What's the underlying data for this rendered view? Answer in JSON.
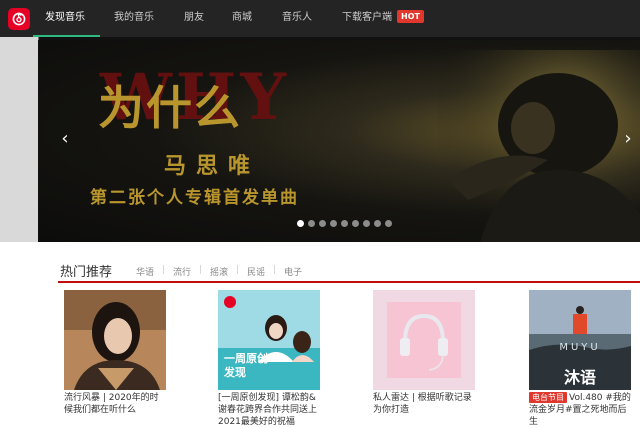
{
  "nav": {
    "items": [
      {
        "label": "发现音乐",
        "active": true
      },
      {
        "label": "我的音乐",
        "active": false
      },
      {
        "label": "朋友",
        "active": false
      },
      {
        "label": "商城",
        "active": false
      },
      {
        "label": "音乐人",
        "active": false
      },
      {
        "label": "下载客户端",
        "active": false
      }
    ],
    "hot_badge": "HOT",
    "active_color": "#2fb87f"
  },
  "banner": {
    "headline": "为什么",
    "watermark": "WHY",
    "artist": "马思唯",
    "subline": "第二张个人专辑首发单曲",
    "prev_arrow": "‹",
    "next_arrow": "›",
    "slide_count": 9,
    "active_slide": 1
  },
  "hot": {
    "title": "热门推荐",
    "tags": [
      "华语",
      "流行",
      "摇滚",
      "民谣",
      "电子"
    ],
    "accent": "#c10d0c",
    "playlists": [
      {
        "caption": "流行风暴 | 2020年的时候我们都在听什么"
      },
      {
        "caption": "[一周原创发现] 谭松韵&谢春花跨界合作共同送上2021最美好的祝福",
        "cover_title": "一周原创发现"
      },
      {
        "caption": "私人雷达 | 根据听歌记录为你打造"
      },
      {
        "badge": "电台节目",
        "caption": "Vol.480 #我的流金岁月#置之死地而后生",
        "cover_title": "沐语",
        "cover_sub": "MUYU"
      }
    ]
  }
}
